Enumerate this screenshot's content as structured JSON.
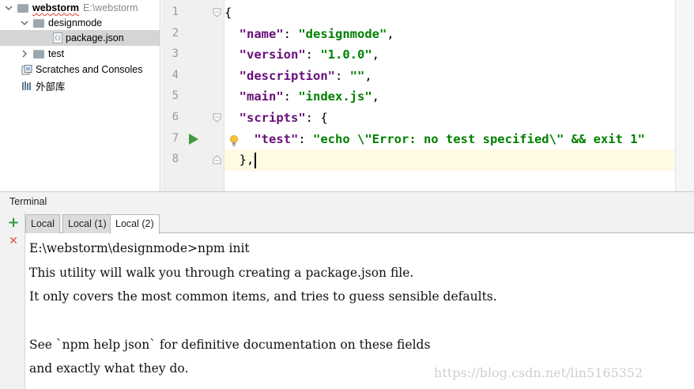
{
  "project_tree": {
    "root": {
      "name": "webstorm",
      "path": "E:\\webstorm"
    },
    "items": [
      {
        "label": "designmode"
      },
      {
        "label": "package.json"
      },
      {
        "label": "test"
      },
      {
        "label": "Scratches and Consoles"
      },
      {
        "label": "外部库"
      }
    ]
  },
  "editor": {
    "line_numbers": [
      "1",
      "2",
      "3",
      "4",
      "5",
      "6",
      "7",
      "8"
    ],
    "lines": [
      {
        "tokens": [
          {
            "t": "p",
            "v": "{"
          }
        ]
      },
      {
        "tokens": [
          {
            "t": "p",
            "v": "  "
          },
          {
            "t": "k",
            "v": "\"name\""
          },
          {
            "t": "p",
            "v": ": "
          },
          {
            "t": "s",
            "v": "\"designmode\""
          },
          {
            "t": "p",
            "v": ","
          }
        ]
      },
      {
        "tokens": [
          {
            "t": "p",
            "v": "  "
          },
          {
            "t": "k",
            "v": "\"version\""
          },
          {
            "t": "p",
            "v": ": "
          },
          {
            "t": "s",
            "v": "\"1.0.0\""
          },
          {
            "t": "p",
            "v": ","
          }
        ]
      },
      {
        "tokens": [
          {
            "t": "p",
            "v": "  "
          },
          {
            "t": "k",
            "v": "\"description\""
          },
          {
            "t": "p",
            "v": ": "
          },
          {
            "t": "s",
            "v": "\"\""
          },
          {
            "t": "p",
            "v": ","
          }
        ]
      },
      {
        "tokens": [
          {
            "t": "p",
            "v": "  "
          },
          {
            "t": "k",
            "v": "\"main\""
          },
          {
            "t": "p",
            "v": ": "
          },
          {
            "t": "s",
            "v": "\"index.js\""
          },
          {
            "t": "p",
            "v": ","
          }
        ]
      },
      {
        "tokens": [
          {
            "t": "p",
            "v": "  "
          },
          {
            "t": "k",
            "v": "\"scripts\""
          },
          {
            "t": "p",
            "v": ": {"
          }
        ]
      },
      {
        "tokens": [
          {
            "t": "p",
            "v": "    "
          },
          {
            "t": "k",
            "v": "\"test\""
          },
          {
            "t": "p",
            "v": ": "
          },
          {
            "t": "s",
            "v": "\"echo \\\"Error: no test specified\\\" && exit 1\""
          }
        ]
      },
      {
        "tokens": [
          {
            "t": "p",
            "v": "  },"
          }
        ]
      }
    ]
  },
  "terminal": {
    "title": "Terminal",
    "toolbar": {
      "add": "+",
      "close": "✕"
    },
    "tabs": [
      "Local",
      "Local (1)",
      "Local (2)"
    ],
    "active_tab": "Local (2)",
    "lines": [
      "E:\\webstorm\\designmode>npm init",
      "This utility will walk you through creating a package.json file.",
      "It only covers the most common items, and tries to guess sensible defaults.",
      "",
      "See `npm help json` for definitive documentation on these fields",
      "and exactly what they do."
    ],
    "watermark": "https://blog.csdn.net/lin5165352"
  },
  "colors": {
    "json_key": "#660e7a",
    "json_string": "#008000",
    "current_line": "#fffae3",
    "add_button": "#2e9a3e",
    "close_button": "#d9534f",
    "run_gutter_icon": "#3f9a3f"
  },
  "icons": {
    "run_gutter": "play-triangle-icon",
    "intention": "lightbulb-icon",
    "folder": "folder-icon",
    "json_file": "json-file-icon",
    "scratches": "scratches-icon",
    "libraries": "library-icon"
  }
}
